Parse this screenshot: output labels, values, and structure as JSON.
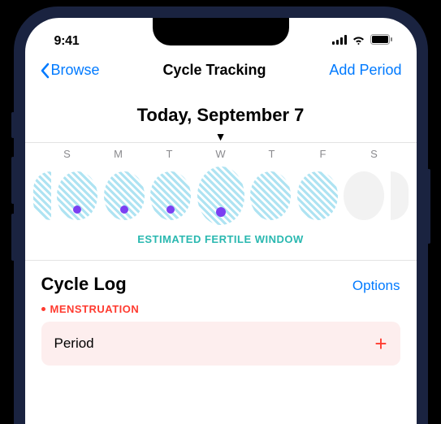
{
  "status": {
    "time": "9:41"
  },
  "nav": {
    "back_label": "Browse",
    "title": "Cycle Tracking",
    "action_label": "Add Period"
  },
  "date_heading": "Today, September 7",
  "week": {
    "days": [
      "S",
      "M",
      "T",
      "W",
      "T",
      "F",
      "S"
    ],
    "fertile_label": "ESTIMATED FERTILE WINDOW",
    "ovals": [
      {
        "fertile": true,
        "dot": true,
        "today": false
      },
      {
        "fertile": true,
        "dot": true,
        "today": false
      },
      {
        "fertile": true,
        "dot": true,
        "today": false
      },
      {
        "fertile": true,
        "dot": true,
        "today": true
      },
      {
        "fertile": true,
        "dot": false,
        "today": false
      },
      {
        "fertile": true,
        "dot": false,
        "today": false
      },
      {
        "fertile": false,
        "dot": false,
        "today": false
      }
    ]
  },
  "cycle_log": {
    "title": "Cycle Log",
    "options_label": "Options",
    "section_label": "MENSTRUATION",
    "period_label": "Period"
  }
}
